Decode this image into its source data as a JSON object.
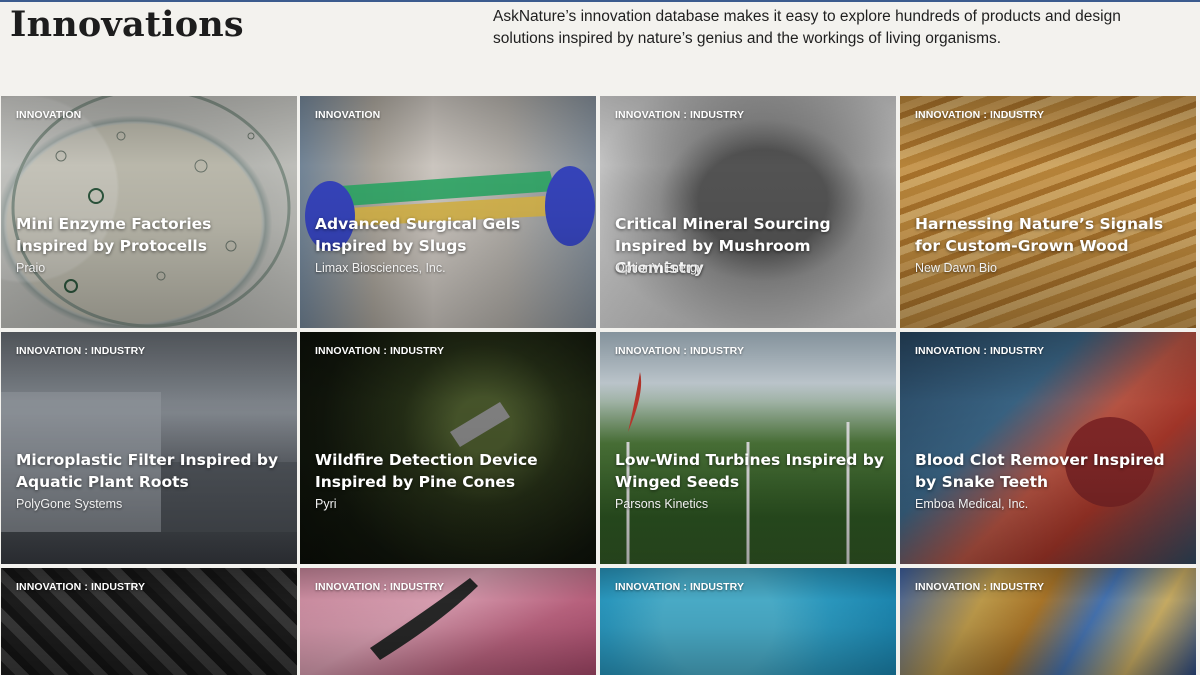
{
  "header": {
    "title": "Innovations",
    "intro": "AskNature’s innovation database makes it easy to explore hundreds of products and design solutions inspired by nature’s genius and the workings of living organisms."
  },
  "cards": [
    {
      "tag": "INNOVATION",
      "title": "Mini Enzyme Factories Inspired by Protocells",
      "org": "Praio"
    },
    {
      "tag": "INNOVATION",
      "title": "Advanced Surgical Gels Inspired by Slugs",
      "org": "Limax Biosciences, Inc."
    },
    {
      "tag": "INNOVATION : INDUSTRY",
      "title": "Critical Mineral Sourcing Inspired by Mushroom Chemistry",
      "org": "OptionV Energy"
    },
    {
      "tag": "INNOVATION : INDUSTRY",
      "title": "Harnessing Nature’s Signals for Custom-Grown Wood",
      "org": "New Dawn Bio"
    },
    {
      "tag": "INNOVATION : INDUSTRY",
      "title": "Microplastic Filter Inspired by Aquatic Plant Roots",
      "org": "PolyGone Systems"
    },
    {
      "tag": "INNOVATION : INDUSTRY",
      "title": "Wildfire Detection Device Inspired by Pine Cones",
      "org": "Pyri"
    },
    {
      "tag": "INNOVATION : INDUSTRY",
      "title": "Low-Wind Turbines Inspired by Winged Seeds",
      "org": "Parsons Kinetics"
    },
    {
      "tag": "INNOVATION : INDUSTRY",
      "title": "Blood Clot Remover Inspired by Snake Teeth",
      "org": "Emboa Medical, Inc."
    },
    {
      "tag": "INNOVATION : INDUSTRY",
      "title": "",
      "org": ""
    },
    {
      "tag": "INNOVATION : INDUSTRY",
      "title": "",
      "org": ""
    },
    {
      "tag": "INNOVATION : INDUSTRY",
      "title": "",
      "org": ""
    },
    {
      "tag": "INNOVATION : INDUSTRY",
      "title": "",
      "org": ""
    }
  ]
}
